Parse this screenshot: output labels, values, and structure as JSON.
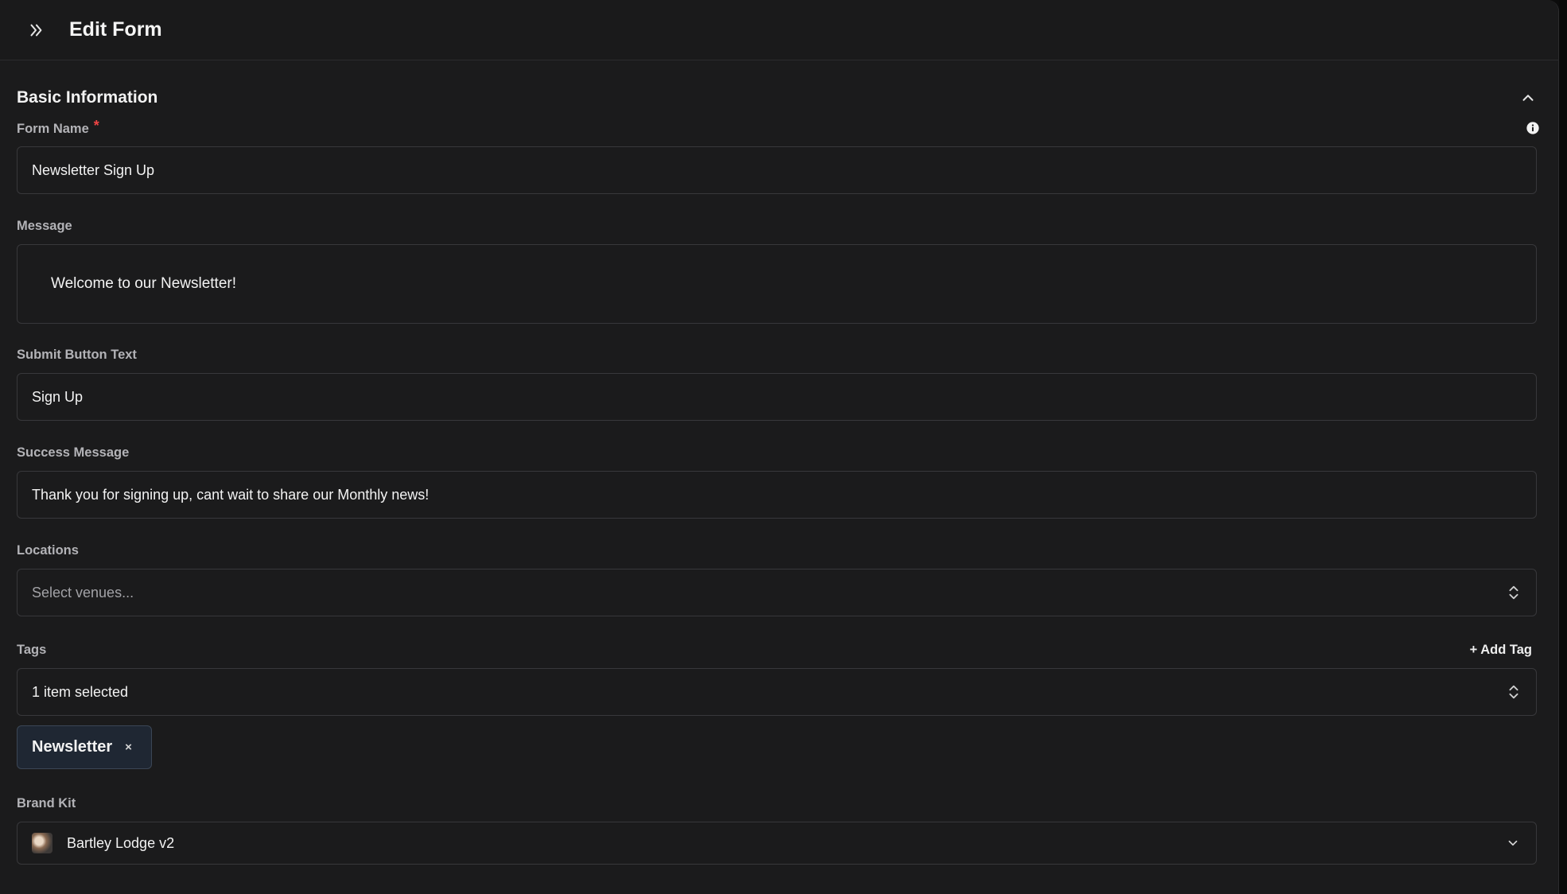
{
  "header": {
    "title": "Edit Form"
  },
  "section": {
    "title": "Basic Information"
  },
  "fields": {
    "form_name": {
      "label": "Form Name",
      "required_mark": "*",
      "value": "Newsletter Sign Up"
    },
    "message": {
      "label": "Message",
      "value": "Welcome to our Newsletter!"
    },
    "submit_button_text": {
      "label": "Submit Button Text",
      "value": "Sign Up"
    },
    "success_message": {
      "label": "Success Message",
      "value": "Thank you for signing up, cant wait to share our Monthly news!"
    },
    "locations": {
      "label": "Locations",
      "placeholder": "Select venues..."
    },
    "tags": {
      "label": "Tags",
      "add_label": "+ Add Tag",
      "value": "1 item selected",
      "chips": [
        "Newsletter"
      ],
      "chip_remove": "×"
    },
    "brand_kit": {
      "label": "Brand Kit",
      "value": "Bartley Lodge v2"
    }
  },
  "icons": {
    "expand": "chevrons-right-icon",
    "collapse": "chevron-up-icon",
    "info": "info-icon",
    "updown": "chevrons-up-down-icon",
    "dropdown": "chevron-down-icon"
  },
  "colors": {
    "background": "#1b1b1c",
    "border": "#38383b",
    "required": "#ef4444",
    "chip_bg": "#1f2733"
  }
}
